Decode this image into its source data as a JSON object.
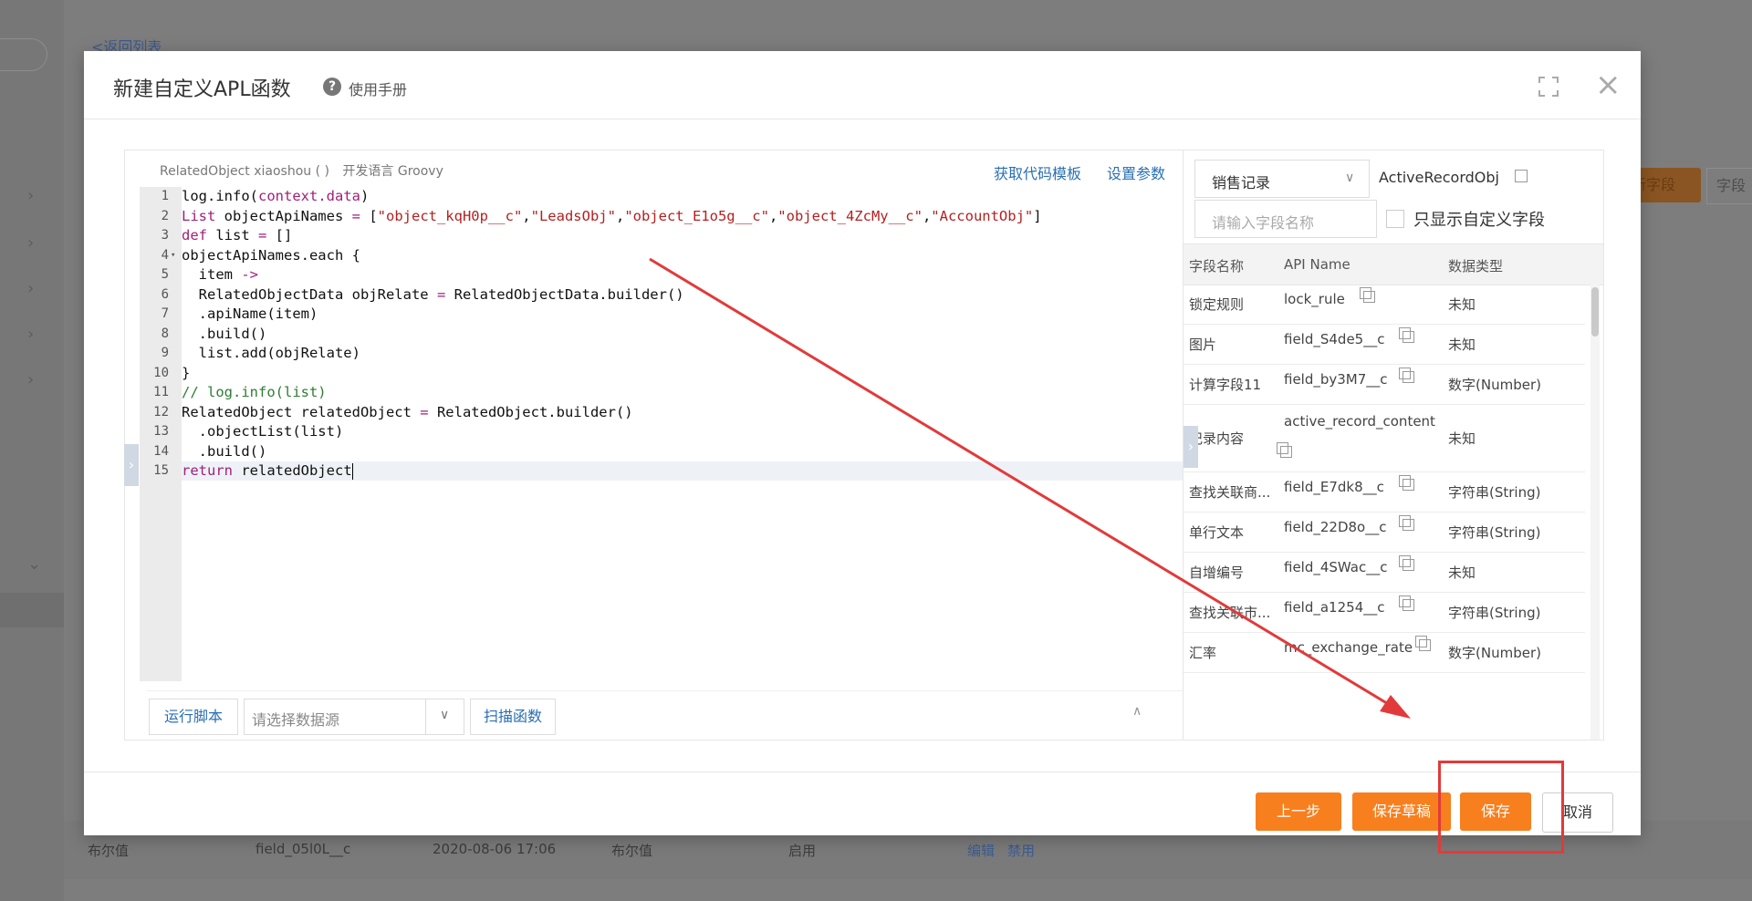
{
  "background": {
    "back_link": "<返回列表",
    "add_field_partial": "新字段",
    "field_partial": "字段",
    "row": {
      "col1": "布尔值",
      "col2": "field_05l0L__c",
      "col3": "2020-08-06 17:06",
      "col4": "布尔值",
      "col5": "启用",
      "edit": "编辑",
      "disable": "禁用"
    }
  },
  "modal": {
    "title": "新建自定义APL函数",
    "help_label": "使用手册",
    "help_icon": "question-circle-icon",
    "fullscreen_icon": "fullscreen-icon",
    "close_icon": "close-icon"
  },
  "editor": {
    "function_name": "RelatedObject xiaoshou ( )",
    "language": "开发语言 Groovy",
    "get_template": "获取代码模板",
    "set_params": "设置参数",
    "lines": [
      {
        "n": "1",
        "text": "log.info(context.data)"
      },
      {
        "n": "2",
        "text": "List objectApiNames = [\"object_kqH0p__c\",\"LeadsObj\",\"object_E1o5g__c\",\"object_4ZcMy__c\",\"AccountObj\"]"
      },
      {
        "n": "3",
        "text": "def list = []"
      },
      {
        "n": "4",
        "text": "objectApiNames.each {"
      },
      {
        "n": "5",
        "text": "  item ->"
      },
      {
        "n": "6",
        "text": "  RelatedObjectData objRelate = RelatedObjectData.builder()"
      },
      {
        "n": "7",
        "text": "  .apiName(item)"
      },
      {
        "n": "8",
        "text": "  .build()"
      },
      {
        "n": "9",
        "text": "  list.add(objRelate)"
      },
      {
        "n": "10",
        "text": "}"
      },
      {
        "n": "11",
        "text": "// log.info(list)"
      },
      {
        "n": "12",
        "text": "RelatedObject relatedObject = RelatedObject.builder()"
      },
      {
        "n": "13",
        "text": "  .objectList(list)"
      },
      {
        "n": "14",
        "text": "  .build()"
      },
      {
        "n": "15",
        "text": "return relatedObject"
      }
    ],
    "run_script": "运行脚本",
    "datasource_placeholder": "请选择数据源",
    "scan_function": "扫描函数"
  },
  "fields_panel": {
    "object_select": "销售记录",
    "object_api": "ActiveRecordObj",
    "search_placeholder": "请输入字段名称",
    "only_custom_label": "只显示自定义字段",
    "only_custom_checked": false,
    "columns": [
      "字段名称",
      "API Name",
      "数据类型"
    ],
    "rows": [
      {
        "name": "锁定规则",
        "api": "lock_rule",
        "type": "未知"
      },
      {
        "name": "图片",
        "api": "field_S4de5__c",
        "type": "未知"
      },
      {
        "name": "计算字段11",
        "api": "field_by3M7__c",
        "type": "数字(Number)"
      },
      {
        "name": "记录内容",
        "api": "active_record_content",
        "type": "未知"
      },
      {
        "name": "查找关联商...",
        "api": "field_E7dk8__c",
        "type": "字符串(String)"
      },
      {
        "name": "单行文本",
        "api": "field_22D8o__c",
        "type": "字符串(String)"
      },
      {
        "name": "自增编号",
        "api": "field_4SWac__c",
        "type": "未知"
      },
      {
        "name": "查找关联市...",
        "api": "field_a1254__c",
        "type": "字符串(String)"
      },
      {
        "name": "汇率",
        "api": "mc_exchange_rate",
        "type": "数字(Number)"
      }
    ]
  },
  "footer": {
    "prev": "上一步",
    "save_draft": "保存草稿",
    "save": "保存",
    "cancel": "取消"
  },
  "colors": {
    "accent_orange": "#f77f1e",
    "link_blue": "#2a6fb5",
    "annotation_red": "#e23a3a"
  }
}
